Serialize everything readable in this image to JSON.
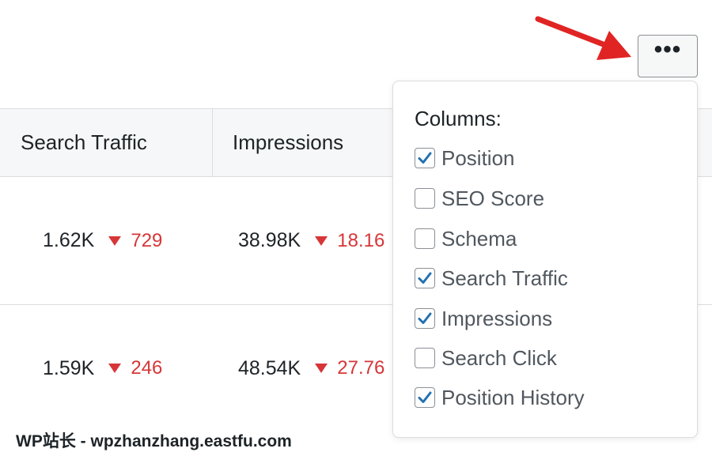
{
  "table": {
    "headers": [
      "Search Traffic",
      "Impressions"
    ],
    "rows": [
      {
        "search_traffic": "1.62K",
        "search_traffic_delta": "729",
        "impressions": "38.98K",
        "impressions_delta": "18.16"
      },
      {
        "search_traffic": "1.59K",
        "search_traffic_delta": "246",
        "impressions": "48.54K",
        "impressions_delta": "27.76"
      }
    ],
    "delta_color": "#d63638"
  },
  "toolbar": {
    "more_label": "•••"
  },
  "arrow_color": "#e02424",
  "columns_menu": {
    "title": "Columns:",
    "options": [
      {
        "label": "Position",
        "checked": true
      },
      {
        "label": "SEO Score",
        "checked": false
      },
      {
        "label": "Schema",
        "checked": false
      },
      {
        "label": "Search Traffic",
        "checked": true
      },
      {
        "label": "Impressions",
        "checked": true
      },
      {
        "label": "Search Click",
        "checked": false
      },
      {
        "label": "Position History",
        "checked": true
      }
    ],
    "check_color": "#2271b1"
  },
  "watermark": "WP站长 - wpzhanzhang.eastfu.com"
}
